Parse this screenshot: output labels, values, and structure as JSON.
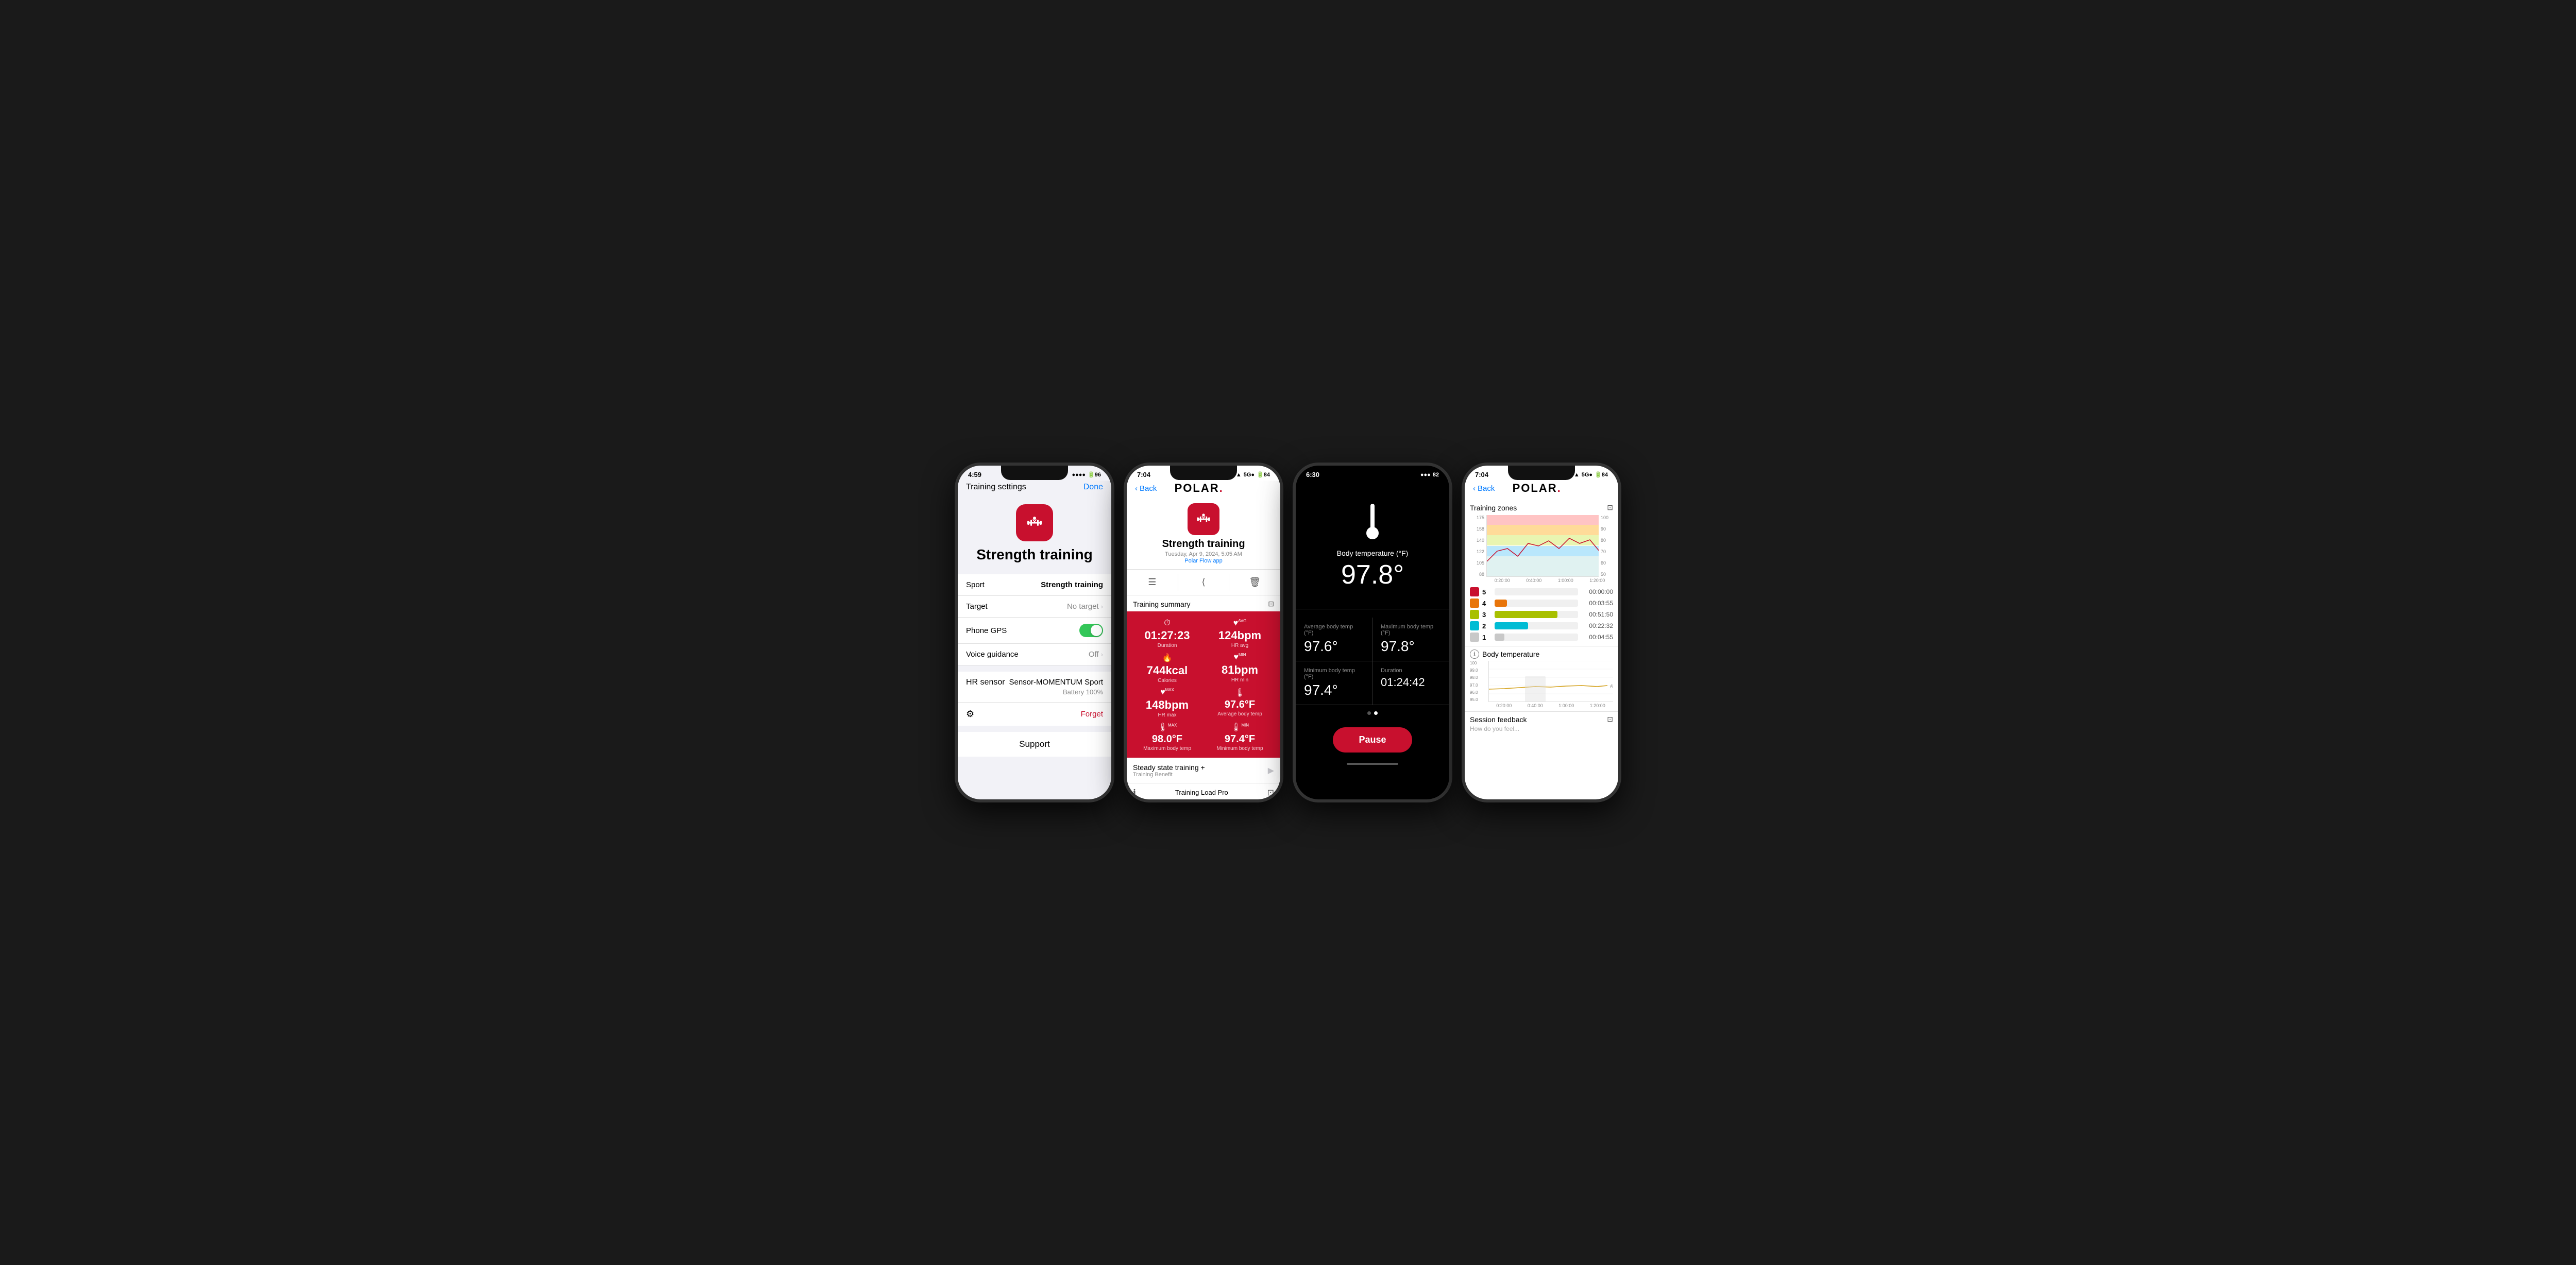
{
  "phones": [
    {
      "id": "phone1",
      "statusBar": {
        "time": "4:59",
        "battery": "96",
        "signal": "●●●●"
      },
      "nav": {
        "title": "Training settings",
        "doneLabel": "Done"
      },
      "sportIcon": "strength-training-icon",
      "sportTitle": "Strength training",
      "settings": [
        {
          "label": "Sport",
          "value": "Strength training",
          "type": "text-strong"
        },
        {
          "label": "Target",
          "value": "No target",
          "type": "arrow"
        },
        {
          "label": "Phone GPS",
          "value": "",
          "type": "toggle"
        },
        {
          "label": "Voice guidance",
          "value": "Off",
          "type": "arrow"
        }
      ],
      "hrSensor": {
        "label": "HR sensor",
        "value": "Sensor-MOMENTUM Sport",
        "battery": "Battery 100%"
      },
      "forgetLabel": "Forget",
      "supportLabel": "Support"
    },
    {
      "id": "phone2",
      "statusBar": {
        "time": "7:04",
        "signal": "5G●",
        "battery": "84"
      },
      "nav": {
        "backLabel": "Back",
        "logoText": "POLAR"
      },
      "workout": {
        "title": "Strength training",
        "date": "Tuesday, Apr 9, 2024, 5:05 AM",
        "app": "Polar Flow app"
      },
      "summaryTitle": "Training summary",
      "stats": [
        {
          "icon": "⏱",
          "value": "01:27:23",
          "label": "Duration",
          "position": "top-left"
        },
        {
          "icon": "♥",
          "value": "124bpm",
          "label": "HR avg",
          "position": "top-right",
          "superscript": "AVG"
        },
        {
          "icon": "🔥",
          "value": "744kcal",
          "label": "Calories",
          "position": "mid-left"
        },
        {
          "icon": "♥",
          "value": "81bpm",
          "label": "HR min",
          "position": "mid-right",
          "superscript": "MIN"
        },
        {
          "icon": "♥",
          "value": "148bpm",
          "label": "HR max",
          "position": "bot-left",
          "superscript": "MAX"
        },
        {
          "icon": "🌡",
          "value": "97.6°F",
          "label": "Average body temp",
          "position": "bot-right"
        },
        {
          "icon": "🌡",
          "value": "98.0°F",
          "label": "Maximum body temp",
          "position": "last-left",
          "superscript": "MAX"
        },
        {
          "icon": "🌡",
          "value": "97.4°F",
          "label": "Minimum body temp",
          "position": "last-right",
          "superscript": "MIN"
        }
      ],
      "benefit": {
        "title": "Steady state training +",
        "sub": "Training Benefit"
      },
      "bottomBar": {
        "infoIcon": "ℹ",
        "title": "Training Load Pro",
        "expandIcon": "⊡"
      }
    },
    {
      "id": "phone3",
      "statusBar": {
        "time": "6:30",
        "battery": "82",
        "signal": "●●●"
      },
      "tempLabel": "Body temperature (°F)",
      "tempValue": "97.8°",
      "stats": [
        {
          "label": "Average body temp (°F)",
          "value": "97.6°"
        },
        {
          "label": "Maximum body temp (°F)",
          "value": "97.8°"
        },
        {
          "label": "Minimum body temp (°F)",
          "value": "97.4°"
        },
        {
          "label": "Duration",
          "value": "01:24:42"
        }
      ],
      "pauseLabel": "Pause"
    },
    {
      "id": "phone4",
      "statusBar": {
        "time": "7:04",
        "signal": "5G●",
        "battery": "84"
      },
      "nav": {
        "backLabel": "Back",
        "logoText": "POLAR"
      },
      "zonesTitle": "Training zones",
      "zonesYAxisLeft": [
        "175",
        "158",
        "140",
        "122",
        "105",
        "88"
      ],
      "zonesYAxisRight": [
        "100",
        "90",
        "80",
        "70",
        "60",
        "50"
      ],
      "zonesXAxis": [
        "0:20:00",
        "0:40:00",
        "1:00:00",
        "1:20:00"
      ],
      "zoneBands": [
        {
          "color": "#ff6b6b",
          "top": "0%",
          "height": "17%",
          "label": "Zone 5"
        },
        {
          "color": "#ffa500",
          "top": "17%",
          "height": "17%",
          "label": "Zone 4"
        },
        {
          "color": "#c8e63c",
          "top": "34%",
          "height": "17%",
          "label": "Zone 3"
        },
        {
          "color": "#4fc3f7",
          "top": "51%",
          "height": "17%",
          "label": "Zone 2"
        },
        {
          "color": "#b2dfdb",
          "top": "68%",
          "height": "32%",
          "label": "Zone 1"
        }
      ],
      "zonesList": [
        {
          "num": "5",
          "color": "#c8102e",
          "time": "00:00:00",
          "barWidth": "0%"
        },
        {
          "num": "4",
          "color": "#e8750a",
          "time": "00:03:55",
          "barWidth": "15%"
        },
        {
          "num": "3",
          "color": "#a8c000",
          "time": "00:51:50",
          "barWidth": "75%"
        },
        {
          "num": "2",
          "color": "#00bcd4",
          "time": "00:22:32",
          "barWidth": "40%"
        },
        {
          "num": "1",
          "color": "#c8c8c8",
          "time": "00:04:55",
          "barWidth": "12%"
        }
      ],
      "bodyTempTitle": "Body temperature",
      "tempChartYAxis": [
        "100",
        "99.0",
        "98.0",
        "97.0",
        "96.0",
        "95.0"
      ],
      "tempAvgLabel": "AVG",
      "sessionFeedbackTitle": "Session feedback",
      "sessionFeedbackSub": "How do you feel..."
    }
  ]
}
